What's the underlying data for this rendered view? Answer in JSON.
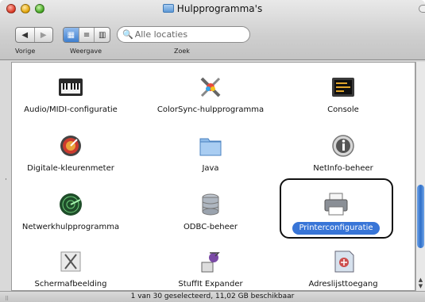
{
  "window": {
    "title": "Hulpprogramma's"
  },
  "toolbar": {
    "nav_labels": [
      "◀",
      "▶"
    ],
    "views": [
      "▦",
      "≡",
      "▥"
    ],
    "search_placeholder": "Alle locaties",
    "label_back": "Vorige",
    "label_view": "Weergave",
    "label_search": "Zoek"
  },
  "items": [
    {
      "label": "Audio/MIDI-configuratie",
      "icon": "keyboard-icon"
    },
    {
      "label": "ColorSync-hulpprogramma",
      "icon": "tools-icon"
    },
    {
      "label": "Console",
      "icon": "console-icon"
    },
    {
      "label": "Digitale-kleurenmeter",
      "icon": "colorimeter-icon"
    },
    {
      "label": "Java",
      "icon": "java-folder-icon"
    },
    {
      "label": "NetInfo-beheer",
      "icon": "netinfo-icon"
    },
    {
      "label": "Netwerkhulpprogramma",
      "icon": "radar-icon"
    },
    {
      "label": "ODBC-beheer",
      "icon": "database-icon"
    },
    {
      "label": "Printerconfiguratie",
      "icon": "printer-icon",
      "selected": true
    },
    {
      "label": "Schermafbeelding",
      "icon": "screenshot-icon"
    },
    {
      "label": "StuffIt Expander",
      "icon": "stuffit-icon"
    },
    {
      "label": "Adreslijsttoegang",
      "icon": "directory-access-icon"
    }
  ],
  "status": {
    "text": "1 van 30 geselecteerd, 11,02 GB beschikbaar"
  },
  "colors": {
    "selection": "#3875d7",
    "scroll_thumb": "#2f6fc8"
  }
}
